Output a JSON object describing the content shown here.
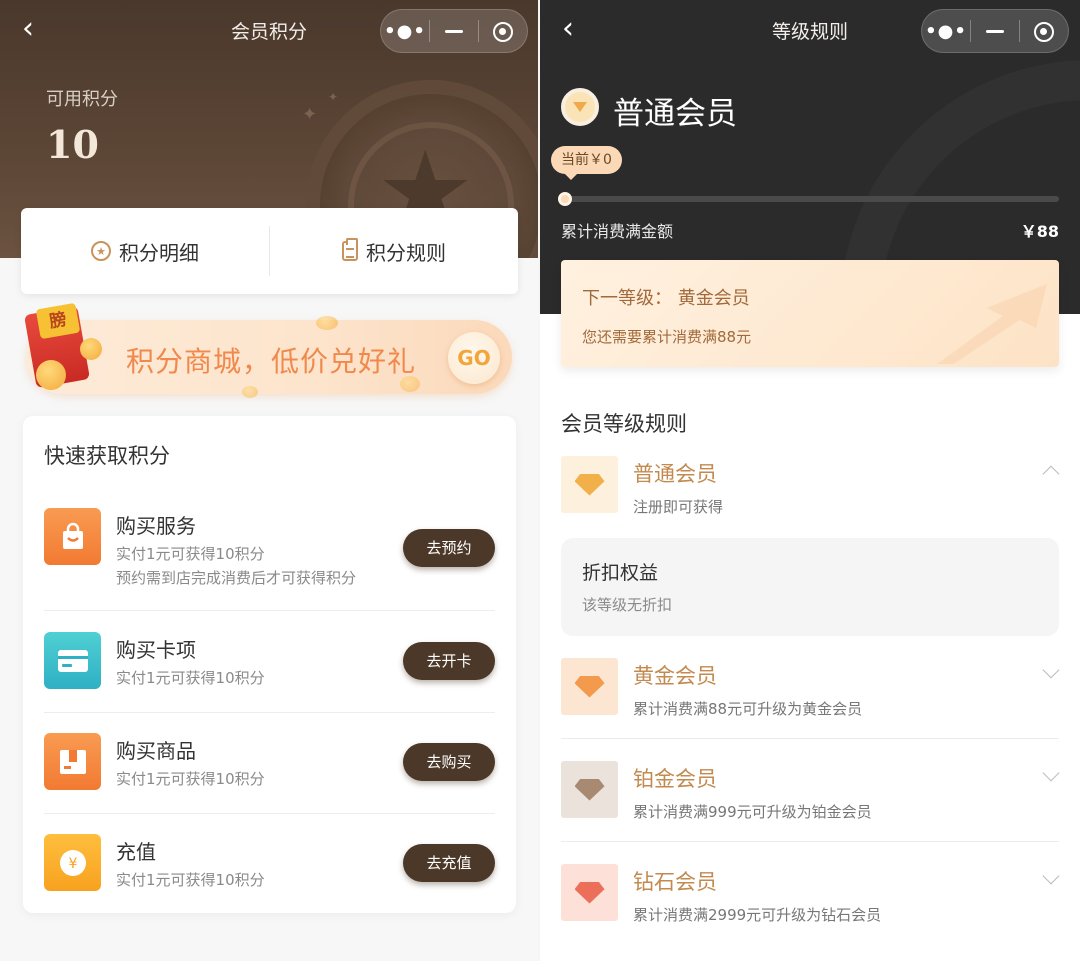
{
  "left": {
    "nav": {
      "title": "会员积分"
    },
    "points": {
      "label": "可用积分",
      "value": "10"
    },
    "tabs": [
      {
        "label": "积分明细",
        "icon": "star-circle-icon"
      },
      {
        "label": "积分规则",
        "icon": "clipboard-icon"
      }
    ],
    "banner": {
      "tag": "膀",
      "text": "积分商城，低价兑好礼",
      "go": "GO"
    },
    "quick": {
      "title": "快速获取积分",
      "items": [
        {
          "name": "购买服务",
          "sub1": "实付1元可获得10积分",
          "sub2": "预约需到店完成消费后才可获得积分",
          "button": "去预约",
          "icon": "shopping-bag-icon",
          "color": "#f4853c"
        },
        {
          "name": "购买卡项",
          "sub1": "实付1元可获得10积分",
          "button": "去开卡",
          "icon": "card-icon",
          "color": "#37b9c6"
        },
        {
          "name": "购买商品",
          "sub1": "实付1元可获得10积分",
          "button": "去购买",
          "icon": "gift-box-icon",
          "color": "#f4853c"
        },
        {
          "name": "充值",
          "sub1": "实付1元可获得10积分",
          "button": "去充值",
          "icon": "yen-coin-icon",
          "color": "#f6a52a"
        }
      ]
    }
  },
  "right": {
    "nav": {
      "title": "等级规则"
    },
    "current": {
      "rank": "普通会员",
      "tip": "当前￥0",
      "accum_label": "累计消费满金额",
      "accum_value": "￥88",
      "progress": 0
    },
    "next": {
      "title": "下一等级： 黄金会员",
      "sub": "您还需要累计消费满88元"
    },
    "rules_title": "会员等级规则",
    "levels": [
      {
        "name": "普通会员",
        "sub": "注册即可获得",
        "expanded": true,
        "name_color": "#c38a4f",
        "bg": "#fdf0dc",
        "gem": "#f2b04a"
      },
      {
        "name": "黄金会员",
        "sub": "累计消费满88元可升级为黄金会员",
        "expanded": false,
        "name_color": "#c38a4f",
        "bg": "#fce6d2",
        "gem": "#f39a4d"
      },
      {
        "name": "铂金会员",
        "sub": "累计消费满999元可升级为铂金会员",
        "expanded": false,
        "name_color": "#c38a4f",
        "bg": "#ece2dc",
        "gem": "#a88a72"
      },
      {
        "name": "钻石会员",
        "sub": "累计消费满2999元可升级为钻石会员",
        "expanded": false,
        "name_color": "#c38a4f",
        "bg": "#fde0d8",
        "gem": "#ec6f5a"
      }
    ],
    "benefit": {
      "title": "折扣权益",
      "sub": "该等级无折扣"
    }
  }
}
